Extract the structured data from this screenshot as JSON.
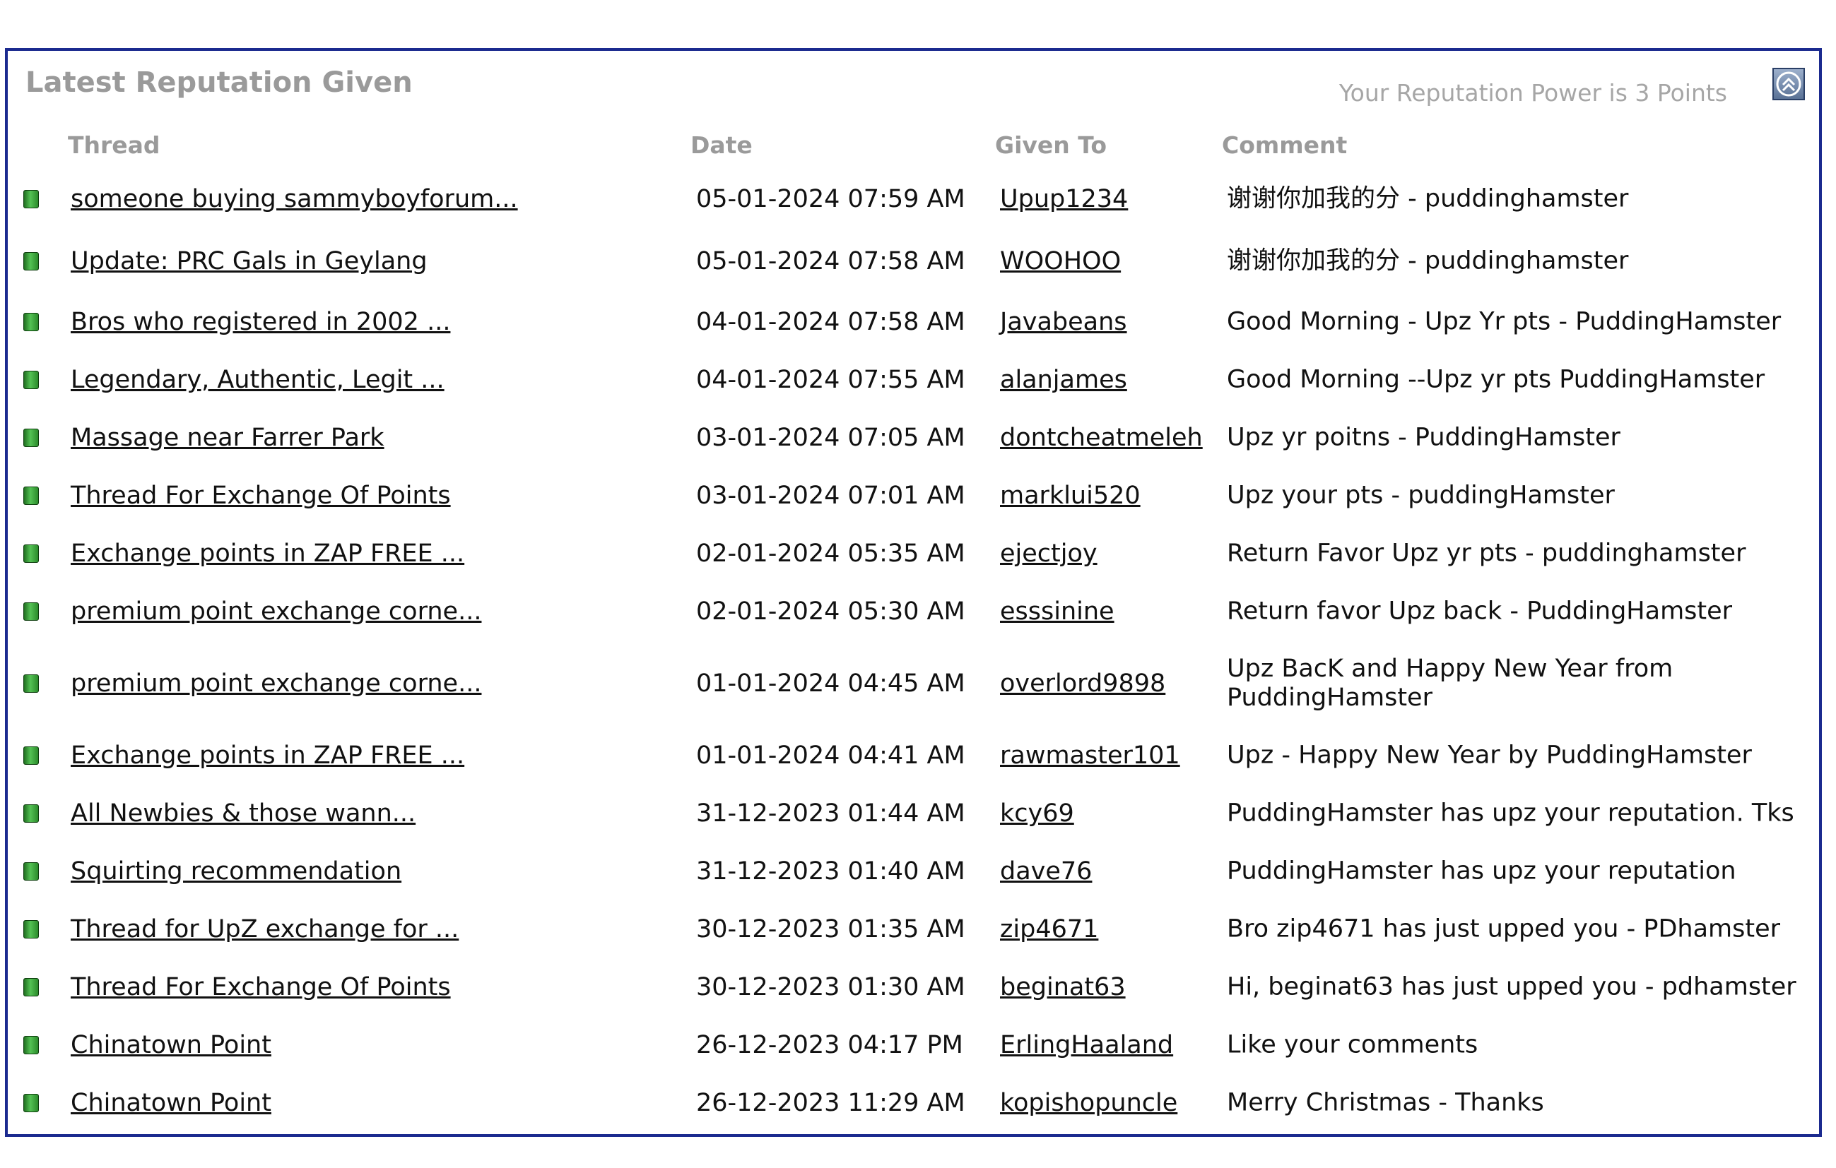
{
  "panel": {
    "title": "Latest Reputation Given",
    "rep_power": "Your Reputation Power is 3 Points",
    "collapse_icon": "collapse-up-icon"
  },
  "columns": {
    "thread": "Thread",
    "date": "Date",
    "given_to": "Given To",
    "comment": "Comment"
  },
  "colors": {
    "border": "#1b2a8f",
    "link": "#1a21a8",
    "header_text": "#9a9a9a",
    "bullet": "#3fae3f"
  },
  "rows": [
    {
      "thread": "someone buying sammyboyforum...",
      "date": "05-01-2024 07:59 AM",
      "user": "Upup1234",
      "comment": "谢谢你加我的分 - puddinghamster"
    },
    {
      "thread": "Update: PRC Gals in Geylang",
      "date": "05-01-2024 07:58 AM",
      "user": "WOOHOO",
      "comment": "谢谢你加我的分 - puddinghamster"
    },
    {
      "thread": "Bros who registered in 2002 ...",
      "date": "04-01-2024 07:58 AM",
      "user": "Javabeans",
      "comment": "Good Morning - Upz Yr pts - PuddingHamster"
    },
    {
      "thread": "Legendary, Authentic, Legit ...",
      "date": "04-01-2024 07:55 AM",
      "user": "alanjames",
      "comment": "Good Morning --Upz yr pts PuddingHamster"
    },
    {
      "thread": "Massage near Farrer Park",
      "date": "03-01-2024 07:05 AM",
      "user": "dontcheatmeleh",
      "comment": "Upz yr poitns - PuddingHamster"
    },
    {
      "thread": "Thread For Exchange Of Points",
      "date": "03-01-2024 07:01 AM",
      "user": "marklui520",
      "comment": "Upz your pts - puddingHamster"
    },
    {
      "thread": "Exchange points in ZAP FREE ...",
      "date": "02-01-2024 05:35 AM",
      "user": "ejectjoy",
      "comment": "Return Favor Upz yr pts - puddinghamster"
    },
    {
      "thread": "premium point exchange corne...",
      "date": "02-01-2024 05:30 AM",
      "user": "esssinine",
      "comment": "Return favor Upz back - PuddingHamster"
    },
    {
      "thread": "premium point exchange corne...",
      "date": "01-01-2024 04:45 AM",
      "user": "overlord9898",
      "comment": "Upz BacK and Happy New Year from PuddingHamster"
    },
    {
      "thread": "Exchange points in ZAP FREE ...",
      "date": "01-01-2024 04:41 AM",
      "user": "rawmaster101",
      "comment": "Upz - Happy New Year by PuddingHamster"
    },
    {
      "thread": "All Newbies & those wann...",
      "date": "31-12-2023 01:44 AM",
      "user": "kcy69",
      "comment": "PuddingHamster has upz your reputation. Tks"
    },
    {
      "thread": "Squirting recommendation",
      "date": "31-12-2023 01:40 AM",
      "user": "dave76",
      "comment": "PuddingHamster has upz your reputation"
    },
    {
      "thread": "Thread for UpZ exchange for ...",
      "date": "30-12-2023 01:35 AM",
      "user": "zip4671",
      "comment": "Bro zip4671 has just upped you - PDhamster"
    },
    {
      "thread": "Thread For Exchange Of Points",
      "date": "30-12-2023 01:30 AM",
      "user": "beginat63",
      "comment": "Hi, beginat63 has just upped you - pdhamster"
    },
    {
      "thread": "Chinatown Point",
      "date": "26-12-2023 04:17 PM",
      "user": "ErlingHaaland",
      "comment": "Like your comments"
    },
    {
      "thread": "Chinatown Point",
      "date": "26-12-2023 11:29 AM",
      "user": "kopishopuncle",
      "comment": "Merry Christmas - Thanks"
    }
  ]
}
